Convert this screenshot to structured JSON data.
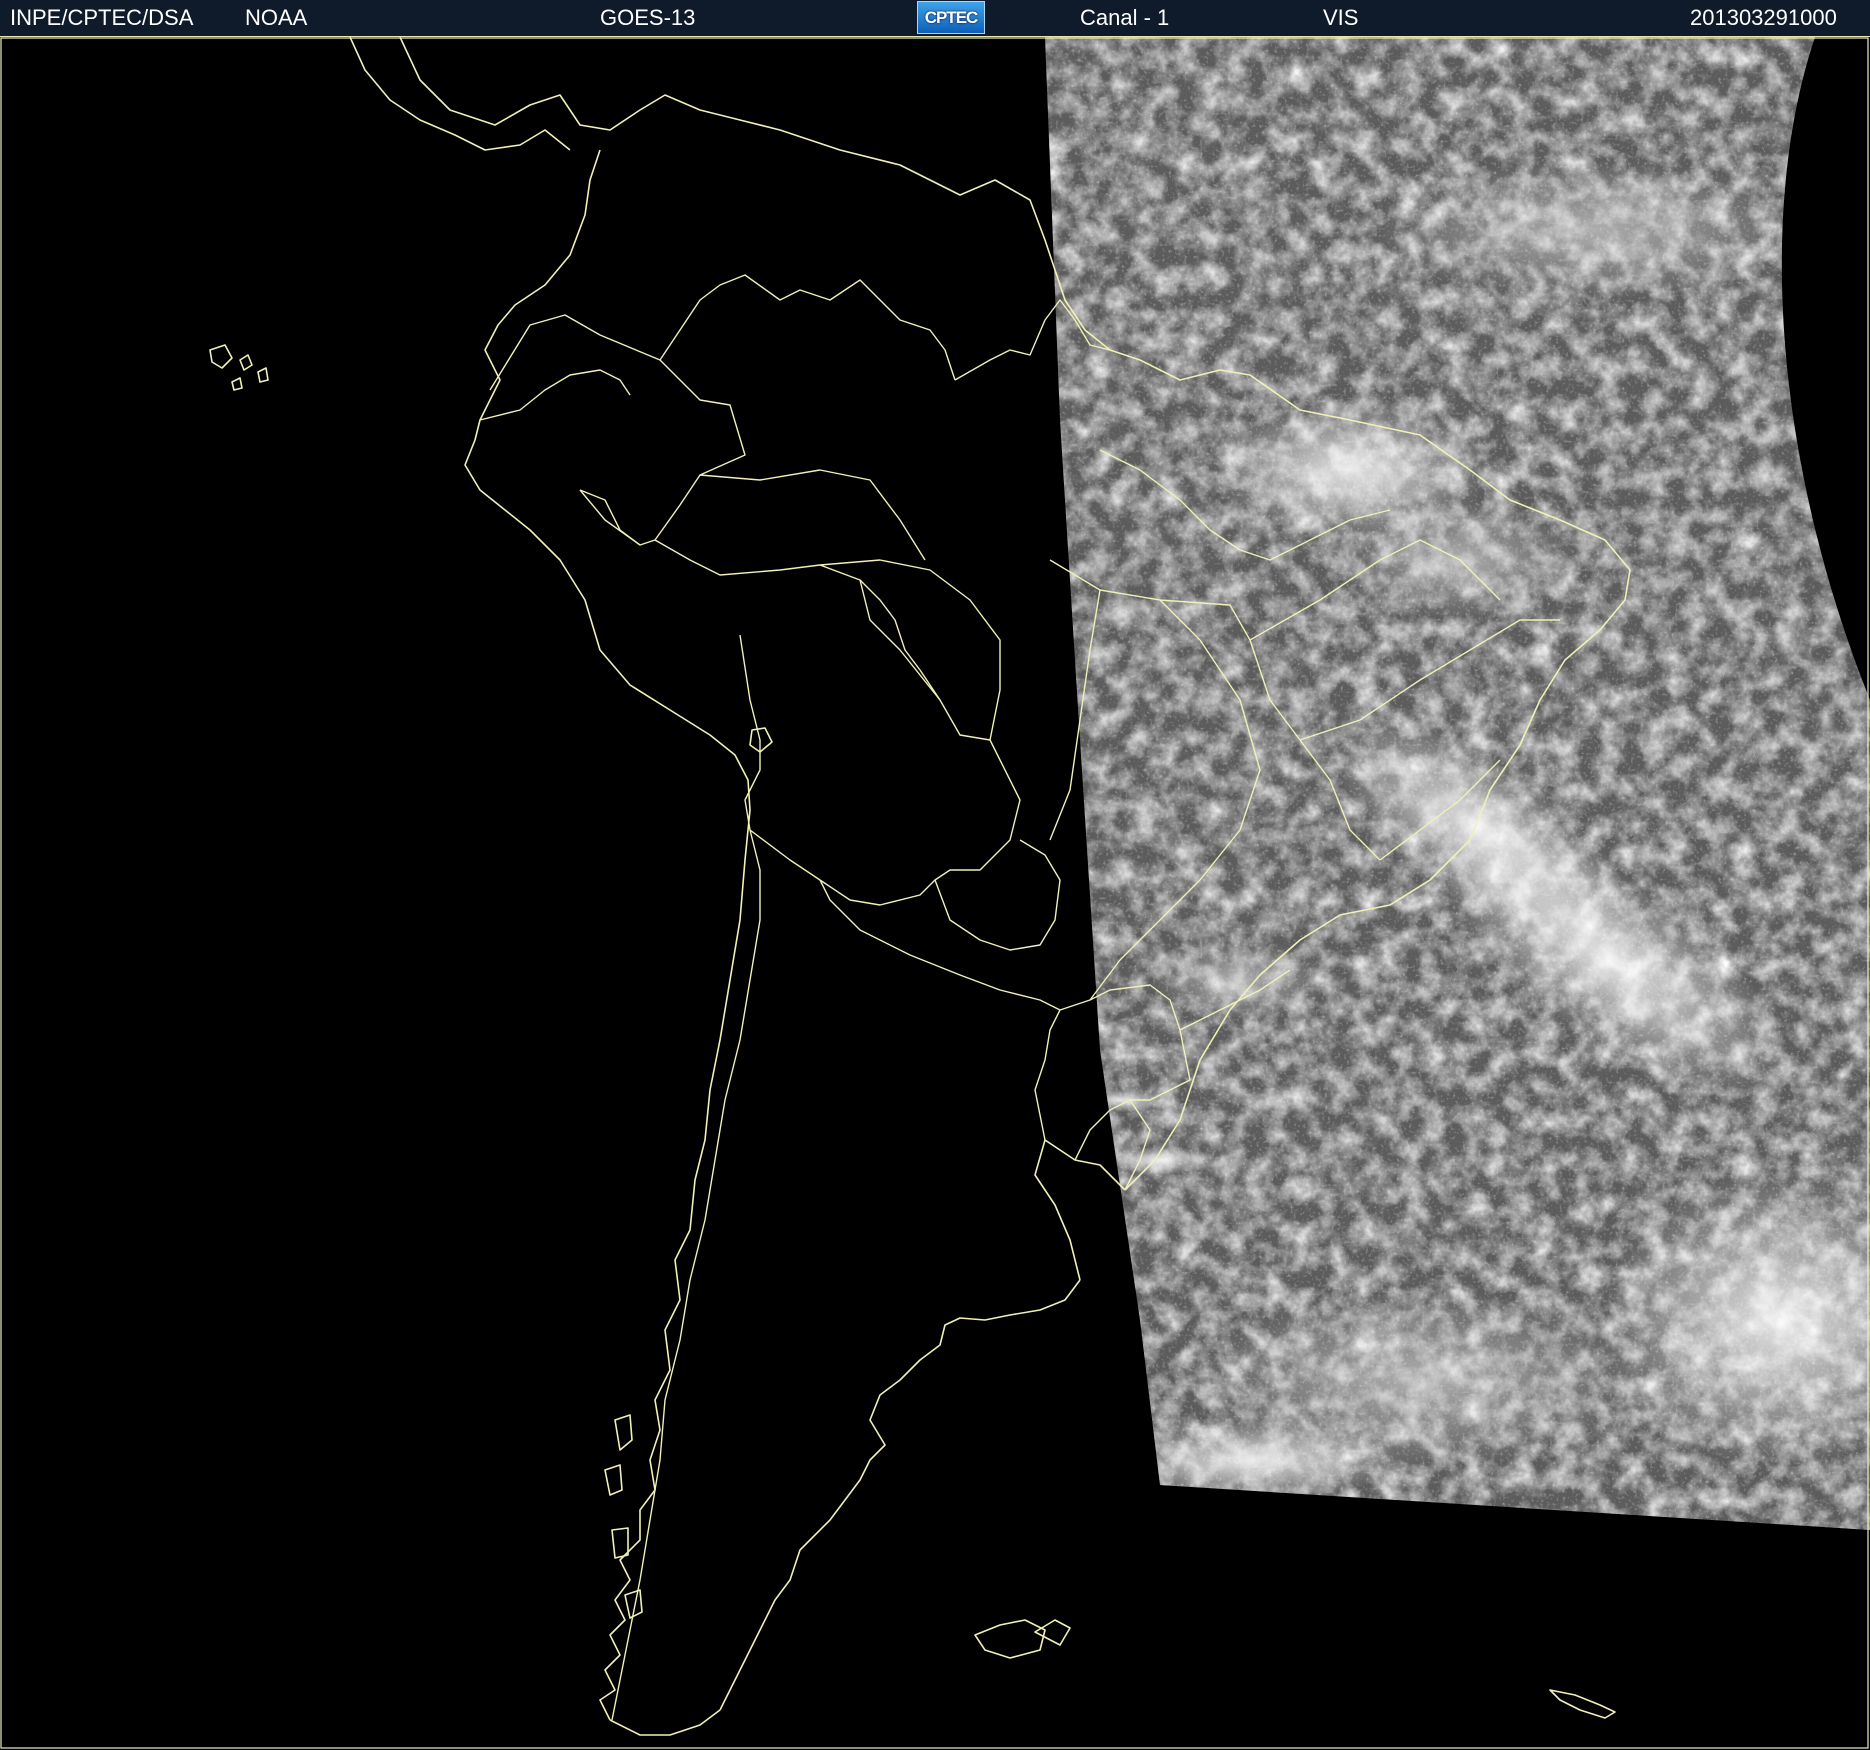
{
  "header": {
    "institution": "INPE/CPTEC/DSA",
    "agency": "NOAA",
    "satellite": "GOES-13",
    "logo_text": "CPTEC",
    "channel": "Canal - 1",
    "band": "VIS",
    "timestamp": "201303291000"
  },
  "colors": {
    "header_bg": "#0f1a2a",
    "map_bg": "#000000",
    "outline": "#f0f0b8",
    "logo": "#2a86d6"
  },
  "icons": {
    "logo": "cptec-logo"
  }
}
